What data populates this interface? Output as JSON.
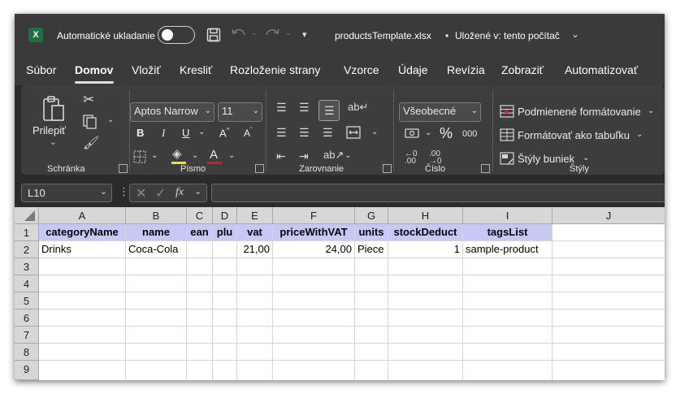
{
  "titlebar": {
    "autosave_label": "Automatické ukladanie",
    "filename": "productsTemplate.xlsx",
    "separator": "•",
    "saved_status": "Uložené v: tento počítač"
  },
  "menu": [
    "Súbor",
    "Domov",
    "Vložiť",
    "Kresliť",
    "Rozloženie strany",
    "Vzorce",
    "Údaje",
    "Revízia",
    "Zobraziť",
    "Automatizovať"
  ],
  "ribbon": {
    "paste_label": "Prilepiť",
    "font_name": "Aptos Narrow",
    "font_size": "11",
    "number_format": "Všeobecné",
    "conditional_formatting": "Podmienené formátovanie",
    "format_as_table": "Formátovať ako tabuľku",
    "cell_styles": "Štýly buniek",
    "bold": "B",
    "italic": "I",
    "underline": "U",
    "percent": "%",
    "thousands": "000",
    "groups": {
      "clipboard": "Schránka",
      "font": "Písmo",
      "alignment": "Zarovnanie",
      "number": "Číslo",
      "styles": "Štýly"
    }
  },
  "formula_bar": {
    "name_box": "L10",
    "fx": "fx",
    "formula": ""
  },
  "sheet": {
    "columns": [
      "A",
      "B",
      "C",
      "D",
      "E",
      "F",
      "G",
      "H",
      "I",
      "J"
    ],
    "rows": [
      "1",
      "2",
      "3",
      "4",
      "5",
      "6",
      "7",
      "8",
      "9"
    ],
    "header_row": [
      "categoryName",
      "name",
      "ean",
      "plu",
      "vat",
      "priceWithVAT",
      "units",
      "stockDeduct",
      "tagsList"
    ],
    "data_row": [
      "Drinks",
      "Coca-Cola",
      "",
      "",
      "21,00",
      "24,00",
      "Piece",
      "1",
      "sample-product"
    ],
    "header_fill": "#c7c9f5"
  },
  "colors": {
    "titlebar": "#3a3a3a",
    "ribbon": "#3d3d3d",
    "excel_green": "#1d7044",
    "font_color_red": "#e81123",
    "highlight_yellow": "#ffe600"
  }
}
